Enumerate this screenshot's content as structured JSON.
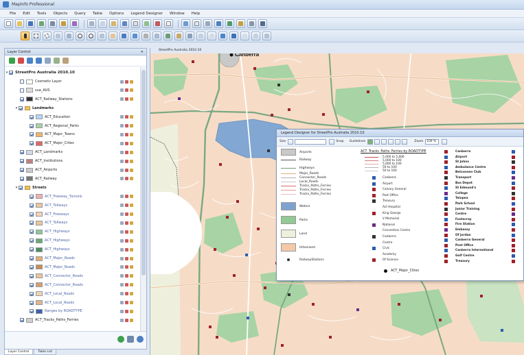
{
  "app": {
    "title": "MapInfo Professional"
  },
  "menu": [
    "File",
    "Edit",
    "Tools",
    "Objects",
    "Query",
    "Table",
    "Options",
    "Legend Designer",
    "Window",
    "Help"
  ],
  "layer_control": {
    "title": "Layer Control",
    "root": "StreetPro Australia 2010.10",
    "rows": [
      {
        "name": "Cosmetic Layer",
        "level": 1,
        "checked": false
      },
      {
        "name": "sua_AUS",
        "level": 1,
        "checked": false
      },
      {
        "name": "ACT_Railway_Stations",
        "level": 1,
        "checked": true
      },
      {
        "name": "Landmarks",
        "level": 1,
        "checked": true,
        "group": true
      },
      {
        "name": "ACT_Education",
        "level": 2,
        "checked": true
      },
      {
        "name": "ACT_Regional_Parks",
        "level": 2,
        "checked": true
      },
      {
        "name": "ACT_Major_Towns",
        "level": 2,
        "checked": true
      },
      {
        "name": "ACT_Major_Cities",
        "level": 2,
        "checked": true
      },
      {
        "name": "ACT_Landmarks",
        "level": 1,
        "checked": true
      },
      {
        "name": "ACT_Institutions",
        "level": 1,
        "checked": true
      },
      {
        "name": "ACT_Airports",
        "level": 1,
        "checked": true
      },
      {
        "name": "ACT_Railway",
        "level": 1,
        "checked": true
      },
      {
        "name": "Streets",
        "level": 1,
        "checked": true,
        "group": true
      },
      {
        "name": "ACT_Freeway_Tunnels",
        "level": 2,
        "checked": true
      },
      {
        "name": "ACT_Tollways",
        "level": 2,
        "checked": true
      },
      {
        "name": "ACT_Freeways",
        "level": 2,
        "checked": true
      },
      {
        "name": "ACT_Tollways",
        "level": 2,
        "checked": true
      },
      {
        "name": "ACT_Highways",
        "level": 2,
        "checked": true
      },
      {
        "name": "ACT_Highways",
        "level": 2,
        "checked": true
      },
      {
        "name": "ACT_Highways",
        "level": 2,
        "checked": true
      },
      {
        "name": "ACT_Major_Roads",
        "level": 2,
        "checked": true
      },
      {
        "name": "ACT_Major_Roads",
        "level": 2,
        "checked": true
      },
      {
        "name": "ACT_Connector_Roads",
        "level": 2,
        "checked": true
      },
      {
        "name": "ACT_Connector_Roads",
        "level": 2,
        "checked": true
      },
      {
        "name": "ACT_Local_Roads",
        "level": 2,
        "checked": true
      },
      {
        "name": "ACT_Local_Roads",
        "level": 2,
        "checked": true
      },
      {
        "name": "Ranges by ROADTYPE",
        "level": 2,
        "checked": true
      },
      {
        "name": "ACT_Tracks_Paths_Ferries",
        "level": 1,
        "checked": true
      }
    ],
    "tabs": [
      "Layer Control",
      "Table List"
    ]
  },
  "map": {
    "window_title": "StreetPro Australia 2010.10",
    "place_label": "Canberra"
  },
  "legend_designer": {
    "title": "Legend Designer for StreetPro Australia 2010.10",
    "toolbar": {
      "size_label": "Size",
      "snap_label": "Snap",
      "guidelines_label": "Guidelines",
      "zoom_label": "Zoom",
      "zoom_value": "100 %"
    },
    "left_items": [
      {
        "label": "Airports",
        "kind": "fill",
        "color": "#c9c9c9"
      },
      {
        "label": "Railway",
        "kind": "line",
        "color": "#555555"
      },
      {
        "label": "Highways",
        "kind": "line",
        "color": "#6f9e76"
      },
      {
        "label": "Major_Roads",
        "kind": "line",
        "color": "#e3b27e"
      },
      {
        "label": "Connector_Roads",
        "kind": "line",
        "color": "#b0b0b0"
      },
      {
        "label": "Local_Roads",
        "kind": "line",
        "color": "#c8c8c8"
      },
      {
        "label": "Tracks_Paths_Ferries",
        "kind": "line",
        "color": "#d66d6d"
      },
      {
        "label": "Tracks_Paths_Ferries",
        "kind": "line",
        "color": "#e89a9a"
      },
      {
        "label": "Tracks_Paths_Ferries",
        "kind": "line",
        "color": "#efbcbc"
      },
      {
        "label": "Waters",
        "kind": "fill",
        "color": "#7ea2cf"
      },
      {
        "label": "Parks",
        "kind": "fill",
        "color": "#93c995"
      },
      {
        "label": "Land",
        "kind": "fill",
        "color": "#eef0dd"
      },
      {
        "label": "Urbanised",
        "kind": "fill",
        "color": "#f4c9a7"
      },
      {
        "label": "RailwayStations",
        "kind": "dot",
        "color": "#333333"
      }
    ],
    "mid_heading": "ACT_Tracks_Paths_Ferries by ROADTYPE",
    "mid_ranges": [
      {
        "from": "5,000",
        "to": "5,000"
      },
      {
        "from": "5,000",
        "to": "100"
      },
      {
        "from": "5,000",
        "to": "100"
      },
      {
        "from": "50",
        "to": "100"
      },
      {
        "from": "50",
        "to": "100"
      }
    ],
    "mid_items": [
      "Canberra",
      "Airport",
      "Calvary General",
      "Post Office",
      "Treasury",
      "Act Hospital",
      "King George",
      "V Memorial",
      "National",
      "Convention Centre",
      "Canberra",
      "Centre",
      "Civic",
      "Academy",
      "Of Science"
    ],
    "mid_footer": "ACT_Major_Cities",
    "right_items": [
      "Canberra",
      "Airport",
      "St Johns",
      "Ambulance Centre",
      "Belconnen Club",
      "Transport",
      "Bus Depot",
      "St Edmund's",
      "College",
      "Telopea",
      "Park School",
      "Junior Training",
      "Centre",
      "Footscray",
      "Fire Station",
      "Embassy",
      "Of Jordan",
      "Canberra General",
      "Post Office",
      "Canberra International",
      "Golf Centre",
      "Treasury"
    ]
  }
}
